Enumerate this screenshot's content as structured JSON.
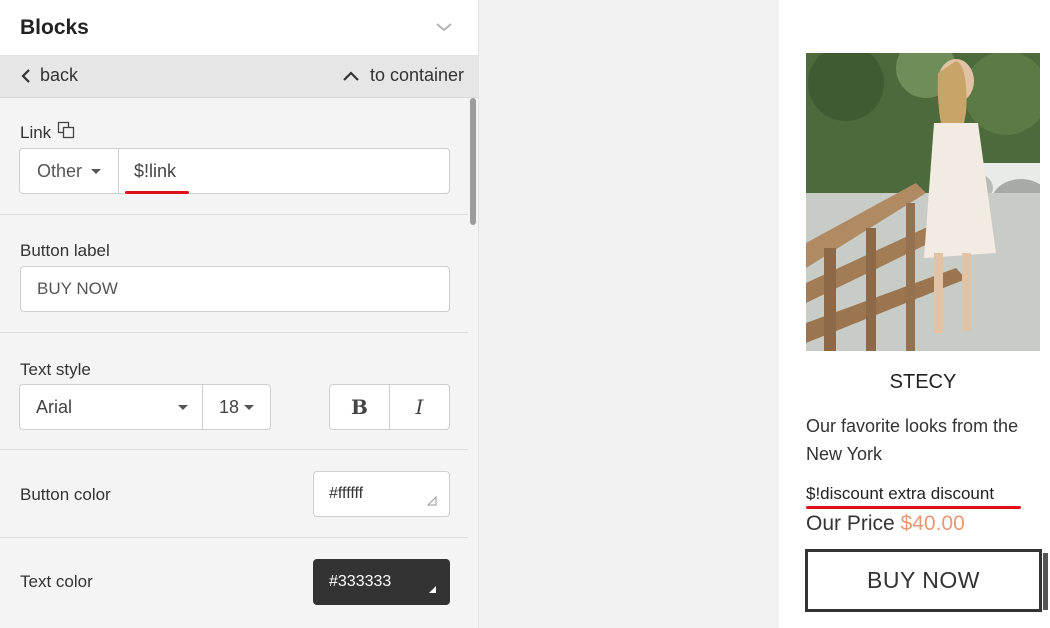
{
  "panel": {
    "title": "Blocks",
    "back_label": "back",
    "container_label": "to container"
  },
  "link": {
    "label": "Link",
    "type": "Other",
    "value": "$!link"
  },
  "button_label": {
    "label": "Button label",
    "value": "BUY NOW"
  },
  "text_style": {
    "label": "Text style",
    "font_family": "Arial",
    "font_size": "18",
    "bold_label": "B",
    "italic_label": "I"
  },
  "button_color": {
    "label": "Button color",
    "value": "#ffffff",
    "swatch_hex": "#ffffff",
    "text_hex": "#333333"
  },
  "text_color": {
    "label": "Text color",
    "value": "#333333",
    "swatch_hex": "#333333",
    "text_hex": "#ffffff"
  },
  "preview": {
    "product_name": "STECY",
    "description": "Our favorite looks from the New York",
    "discount_text": "$!discount extra discount",
    "price_label": "Our Price",
    "price_value": "$40.00",
    "buy_label": "BUY NOW"
  },
  "colors": {
    "accent_red": "#e0101a",
    "price_color": "#e59a75"
  },
  "icons": [
    "chevron-down-icon",
    "chevron-left-icon",
    "chevron-up-icon",
    "copy-icon",
    "caret-down-icon",
    "resize-corner-icon"
  ]
}
